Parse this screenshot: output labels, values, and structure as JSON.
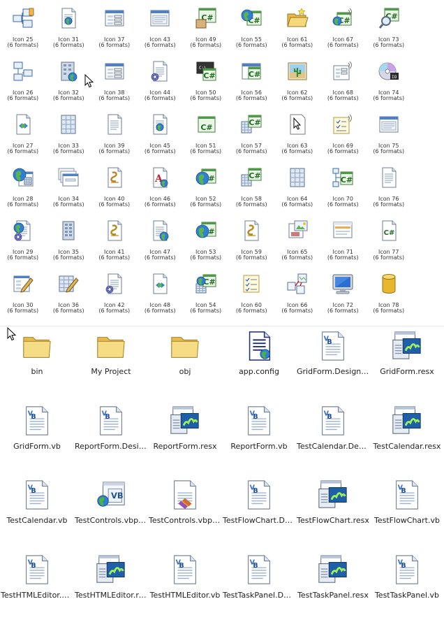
{
  "icon_panel": {
    "format_label": "(6 formats)",
    "icons": [
      {
        "label": "Icon 25",
        "icon": "vb-class-diagram"
      },
      {
        "label": "Icon 31",
        "icon": "web-document-globe"
      },
      {
        "label": "Icon 37",
        "icon": "form-window"
      },
      {
        "label": "Icon 43",
        "icon": "window-dialog"
      },
      {
        "label": "Icon 49",
        "icon": "csharp-code-tool"
      },
      {
        "label": "Icon 55",
        "icon": "csharp-web-globe"
      },
      {
        "label": "Icon 61",
        "icon": "open-folder-star"
      },
      {
        "label": "Icon 67",
        "icon": "csharp-wireless"
      },
      {
        "label": "Icon 73",
        "icon": "csharp-search"
      },
      {
        "label": "Icon 26",
        "icon": "class-diagram"
      },
      {
        "label": "Icon 32",
        "icon": "building-globe"
      },
      {
        "label": "Icon 38",
        "icon": "form-window"
      },
      {
        "label": "Icon 44",
        "icon": "document-gear"
      },
      {
        "label": "Icon 50",
        "icon": "csharp-console"
      },
      {
        "label": "Icon 56",
        "icon": "csharp-form"
      },
      {
        "label": "Icon 62",
        "icon": "picture-cactus"
      },
      {
        "label": "Icon 68",
        "icon": "form-wireless"
      },
      {
        "label": "Icon 74",
        "icon": "cd-setup"
      },
      {
        "label": "Icon 27",
        "icon": "document-arrows"
      },
      {
        "label": "Icon 33",
        "icon": "table-grid"
      },
      {
        "label": "Icon 39",
        "icon": "text-document"
      },
      {
        "label": "Icon 45",
        "icon": "web-document-globe"
      },
      {
        "label": "Icon 51",
        "icon": "csharp-window"
      },
      {
        "label": "Icon 57",
        "icon": "csharp-grid"
      },
      {
        "label": "Icon 63",
        "icon": "pointer-document"
      },
      {
        "label": "Icon 69",
        "icon": "checklist-wireless"
      },
      {
        "label": "Icon 75",
        "icon": "window-dialog"
      },
      {
        "label": "Icon 28",
        "icon": "web-form-globe"
      },
      {
        "label": "Icon 34",
        "icon": "stacked-forms"
      },
      {
        "label": "Icon 40",
        "icon": "script-document"
      },
      {
        "label": "Icon 46",
        "icon": "font-document"
      },
      {
        "label": "Icon 52",
        "icon": "csharp-globe"
      },
      {
        "label": "Icon 58",
        "icon": "csharp-grid"
      },
      {
        "label": "Icon 64",
        "icon": "table-grid"
      },
      {
        "label": "Icon 70",
        "icon": "csharp-network"
      },
      {
        "label": "Icon 76",
        "icon": "text-document"
      },
      {
        "label": "Icon 29",
        "icon": "document-gear-globe"
      },
      {
        "label": "Icon 35",
        "icon": "building-grid"
      },
      {
        "label": "Icon 41",
        "icon": "script-document"
      },
      {
        "label": "Icon 47",
        "icon": "document-globe-lines"
      },
      {
        "label": "Icon 53",
        "icon": "csharp-globe"
      },
      {
        "label": "Icon 59",
        "icon": "script-document"
      },
      {
        "label": "Icon 65",
        "icon": "image-document"
      },
      {
        "label": "Icon 71",
        "icon": "toolbar-window"
      },
      {
        "label": "Icon 77",
        "icon": "csharp-document"
      },
      {
        "label": "Icon 30",
        "icon": "edit-form"
      },
      {
        "label": "Icon 36",
        "icon": "edit-grid"
      },
      {
        "label": "Icon 42",
        "icon": "document-gear"
      },
      {
        "label": "Icon 48",
        "icon": "document-arrows"
      },
      {
        "label": "Icon 54",
        "icon": "csharp-grid-globe"
      },
      {
        "label": "Icon 60",
        "icon": "checklist"
      },
      {
        "label": "Icon 66",
        "icon": "hierarchy-diagram"
      },
      {
        "label": "Icon 72",
        "icon": "monitor"
      },
      {
        "label": "Icon 78",
        "icon": "database-cylinder"
      }
    ]
  },
  "explorer": {
    "files": [
      {
        "name": "bin",
        "type": "folder"
      },
      {
        "name": "My Project",
        "type": "folder"
      },
      {
        "name": "obj",
        "type": "folder"
      },
      {
        "name": "app.config",
        "type": "config"
      },
      {
        "name": "GridForm.Designer.vb",
        "type": "vb"
      },
      {
        "name": "GridForm.resx",
        "type": "resx"
      },
      {
        "name": "GridForm.vb",
        "type": "vb"
      },
      {
        "name": "ReportForm.Designer.vb",
        "type": "vb"
      },
      {
        "name": "ReportForm.resx",
        "type": "resx"
      },
      {
        "name": "ReportForm.vb",
        "type": "vb"
      },
      {
        "name": "TestCalendar.Designer.vb",
        "type": "vb"
      },
      {
        "name": "TestCalendar.resx",
        "type": "resx"
      },
      {
        "name": "TestCalendar.vb",
        "type": "vb"
      },
      {
        "name": "TestControls.vbproj",
        "type": "vbproj"
      },
      {
        "name": "TestControls.vbproj.user",
        "type": "vbproj-user"
      },
      {
        "name": "TestFlowChart.Designer.vb",
        "type": "vb"
      },
      {
        "name": "TestFlowChart.resx",
        "type": "resx"
      },
      {
        "name": "TestFlowChart.vb",
        "type": "vb"
      },
      {
        "name": "TestHTMLEditor.Designer.vb",
        "type": "vb"
      },
      {
        "name": "TestHTMLEditor.resx",
        "type": "resx"
      },
      {
        "name": "TestHTMLEditor.vb",
        "type": "vb"
      },
      {
        "name": "TestTaskPanel.Designer.vb",
        "type": "vb"
      },
      {
        "name": "TestTaskPanel.resx",
        "type": "resx"
      },
      {
        "name": "TestTaskPanel.vb",
        "type": "vb"
      }
    ]
  }
}
